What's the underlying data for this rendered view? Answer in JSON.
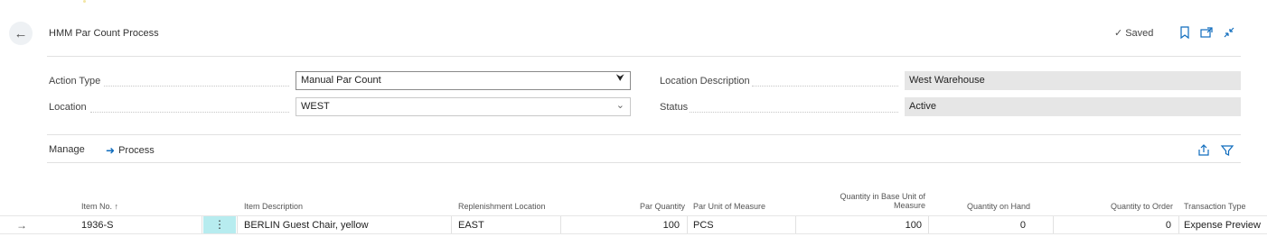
{
  "header": {
    "back_icon": "arrow-left-icon",
    "title": "HMM Par Count Process",
    "saved_label": "Saved",
    "icons": [
      "bookmark-icon",
      "open-new-window-icon",
      "collapse-icon"
    ]
  },
  "fields": {
    "action_type": {
      "label": "Action Type",
      "value": "Manual Par Count"
    },
    "location": {
      "label": "Location",
      "value": "WEST"
    },
    "location_description": {
      "label": "Location Description",
      "value": "West Warehouse"
    },
    "status": {
      "label": "Status",
      "value": "Active"
    }
  },
  "actions": {
    "manage_label": "Manage",
    "process_label": "Process",
    "share_icon": "share-icon",
    "filter_icon": "filter-icon"
  },
  "table": {
    "columns": {
      "item_no": "Item No. ↑",
      "item_description": "Item Description",
      "replenishment_location": "Replenishment Location",
      "par_quantity": "Par Quantity",
      "par_unit": "Par Unit of Measure",
      "qty_base": "Quantity in Base Unit of Measure",
      "qty_on_hand": "Quantity on Hand",
      "qty_to_order": "Quantity to Order",
      "transaction_type": "Transaction Type"
    },
    "rows": [
      {
        "item_no": "1936-S",
        "item_description": "BERLIN Guest Chair, yellow",
        "replenishment_location": "EAST",
        "par_quantity": "100",
        "par_unit": "PCS",
        "qty_base": "100",
        "qty_on_hand": "0",
        "qty_to_order": "0",
        "transaction_type": "Expense Preview"
      }
    ]
  },
  "colors": {
    "accent": "#0f6cbd",
    "selected_cell": "#b7ecef",
    "readonly_bg": "#e6e6e6"
  }
}
